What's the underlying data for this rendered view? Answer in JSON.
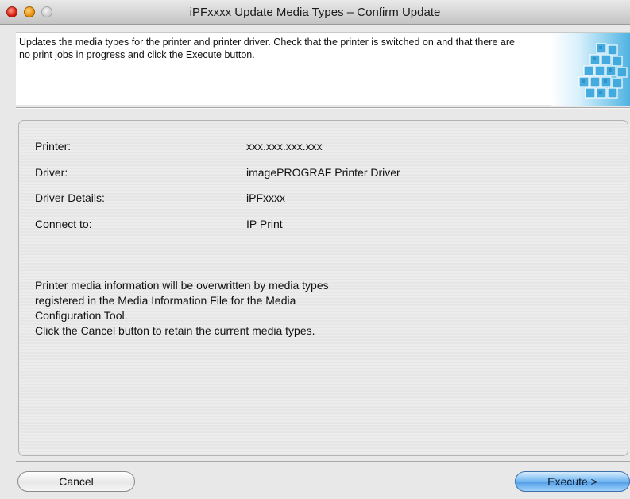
{
  "window": {
    "title": "iPFxxxx Update Media Types – Confirm Update"
  },
  "banner": {
    "description": "Updates the media types for the printer and printer driver. Check that the printer is switched on and that there are no print jobs in progress and click the Execute button.",
    "icon": "stacked-blocks-icon"
  },
  "details": {
    "rows": [
      {
        "label": "Printer:",
        "value": "xxx.xxx.xxx.xxx"
      },
      {
        "label": "Driver:",
        "value": "imagePROGRAF Printer Driver"
      },
      {
        "label": "Driver Details:",
        "value": "iPFxxxx"
      },
      {
        "label": "Connect to:",
        "value": "IP Print"
      }
    ]
  },
  "message": {
    "line1": "Printer media information will be overwritten by media types",
    "line2": "registered in the Media Information File for the Media",
    "line3": "Configuration Tool.",
    "line4": "Click the Cancel button to retain the current media types."
  },
  "buttons": {
    "cancel_label": "Cancel",
    "execute_label": "Execute >"
  },
  "colors": {
    "accent": "#6fb5f0",
    "close": "#d81e0f",
    "minimize": "#e8920b"
  }
}
